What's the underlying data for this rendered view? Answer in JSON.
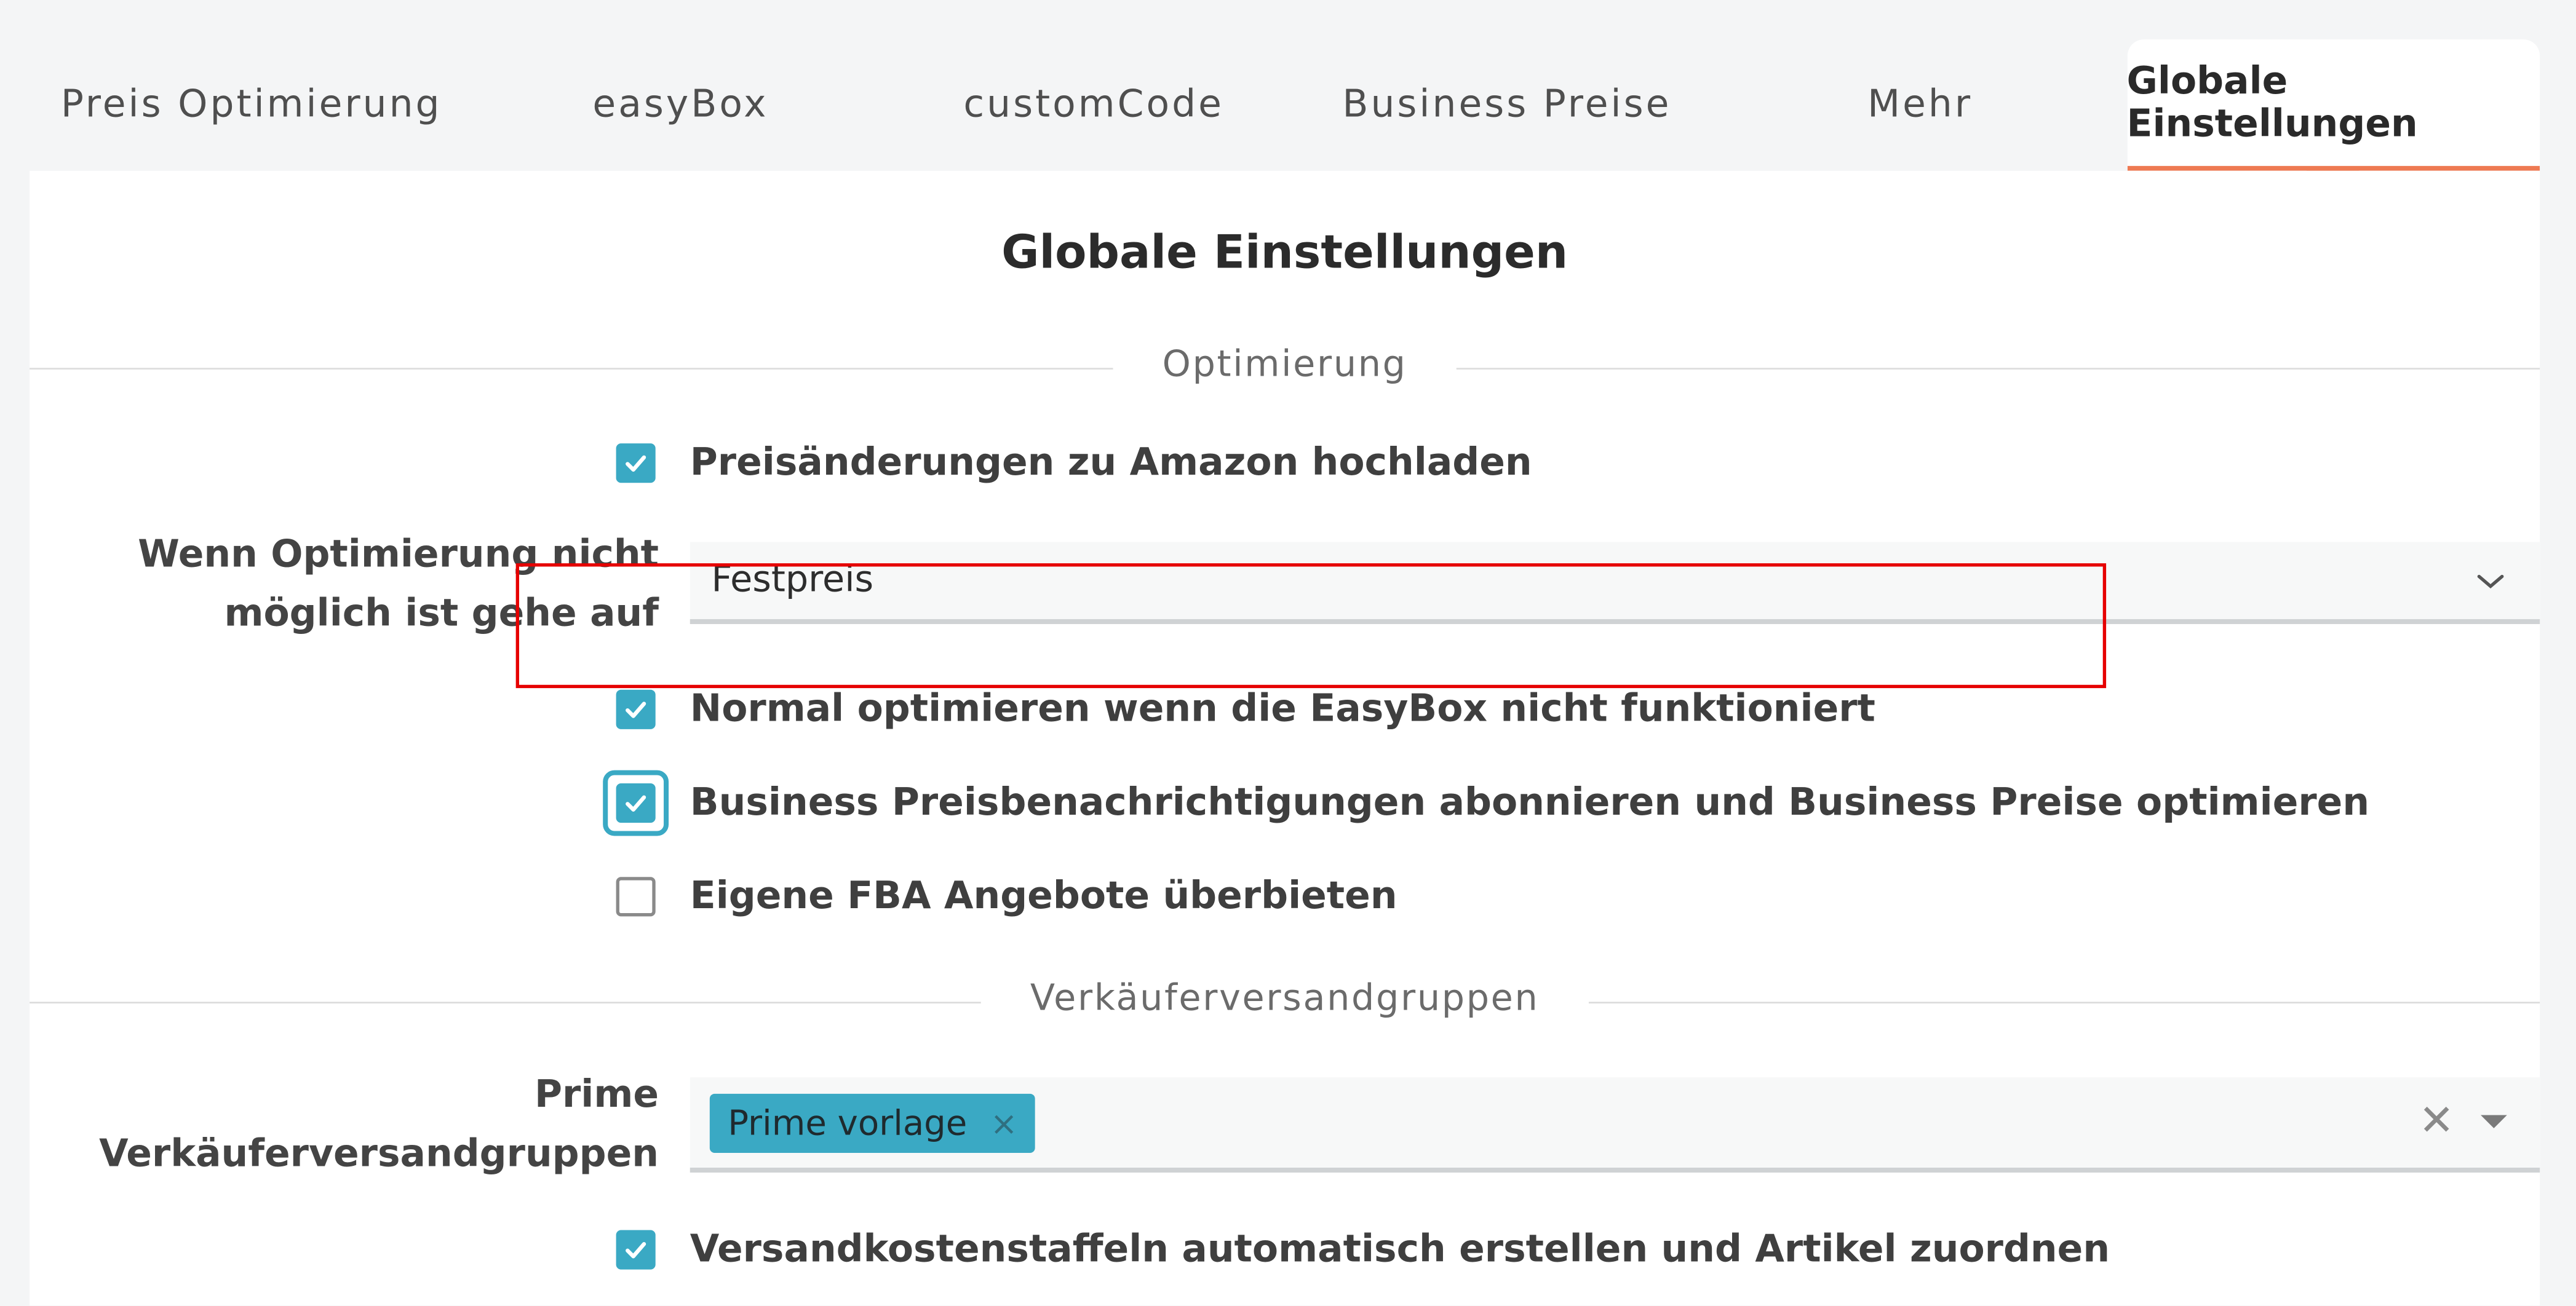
{
  "colors": {
    "accent": "#3aa9c4",
    "active_tab_underline": "#ee7a53",
    "annotation_highlight": "#e60000"
  },
  "tabs": [
    {
      "label": "Preis Optimierung",
      "active": false
    },
    {
      "label": "easyBox",
      "active": false
    },
    {
      "label": "customCode",
      "active": false
    },
    {
      "label": "Business Preise",
      "active": false
    },
    {
      "label": "Mehr",
      "active": false
    },
    {
      "label": "Globale Einstellungen",
      "active": true
    }
  ],
  "panel": {
    "title": "Globale Einstellungen",
    "sections": {
      "optimierung": "Optimierung",
      "versand": "Verkäuferversandgruppen"
    },
    "checks": {
      "upload": {
        "label": "Preisänderungen zu Amazon hochladen",
        "checked": true
      },
      "easybox_fallback": {
        "label": "Normal optimieren wenn die EasyBox nicht funktioniert",
        "checked": true
      },
      "business": {
        "label": "Business Preisbenachrichtigungen abonnieren und Business Preise optimieren",
        "checked": true,
        "focused": true
      },
      "fba": {
        "label": "Eigene FBA Angebote überbieten",
        "checked": false
      },
      "staffeln": {
        "label": "Versandkostenstaffeln automatisch erstellen und Artikel zuordnen",
        "checked": true
      }
    },
    "fallback": {
      "label_line1": "Wenn Optimierung nicht",
      "label_line2": "möglich ist gehe auf",
      "value": "Festpreis"
    },
    "prime": {
      "label_line1": "Prime",
      "label_line2": "Verkäuferversandgruppen",
      "tag": "Prime vorlage",
      "tag_remove": "×",
      "clear": "✕"
    }
  }
}
